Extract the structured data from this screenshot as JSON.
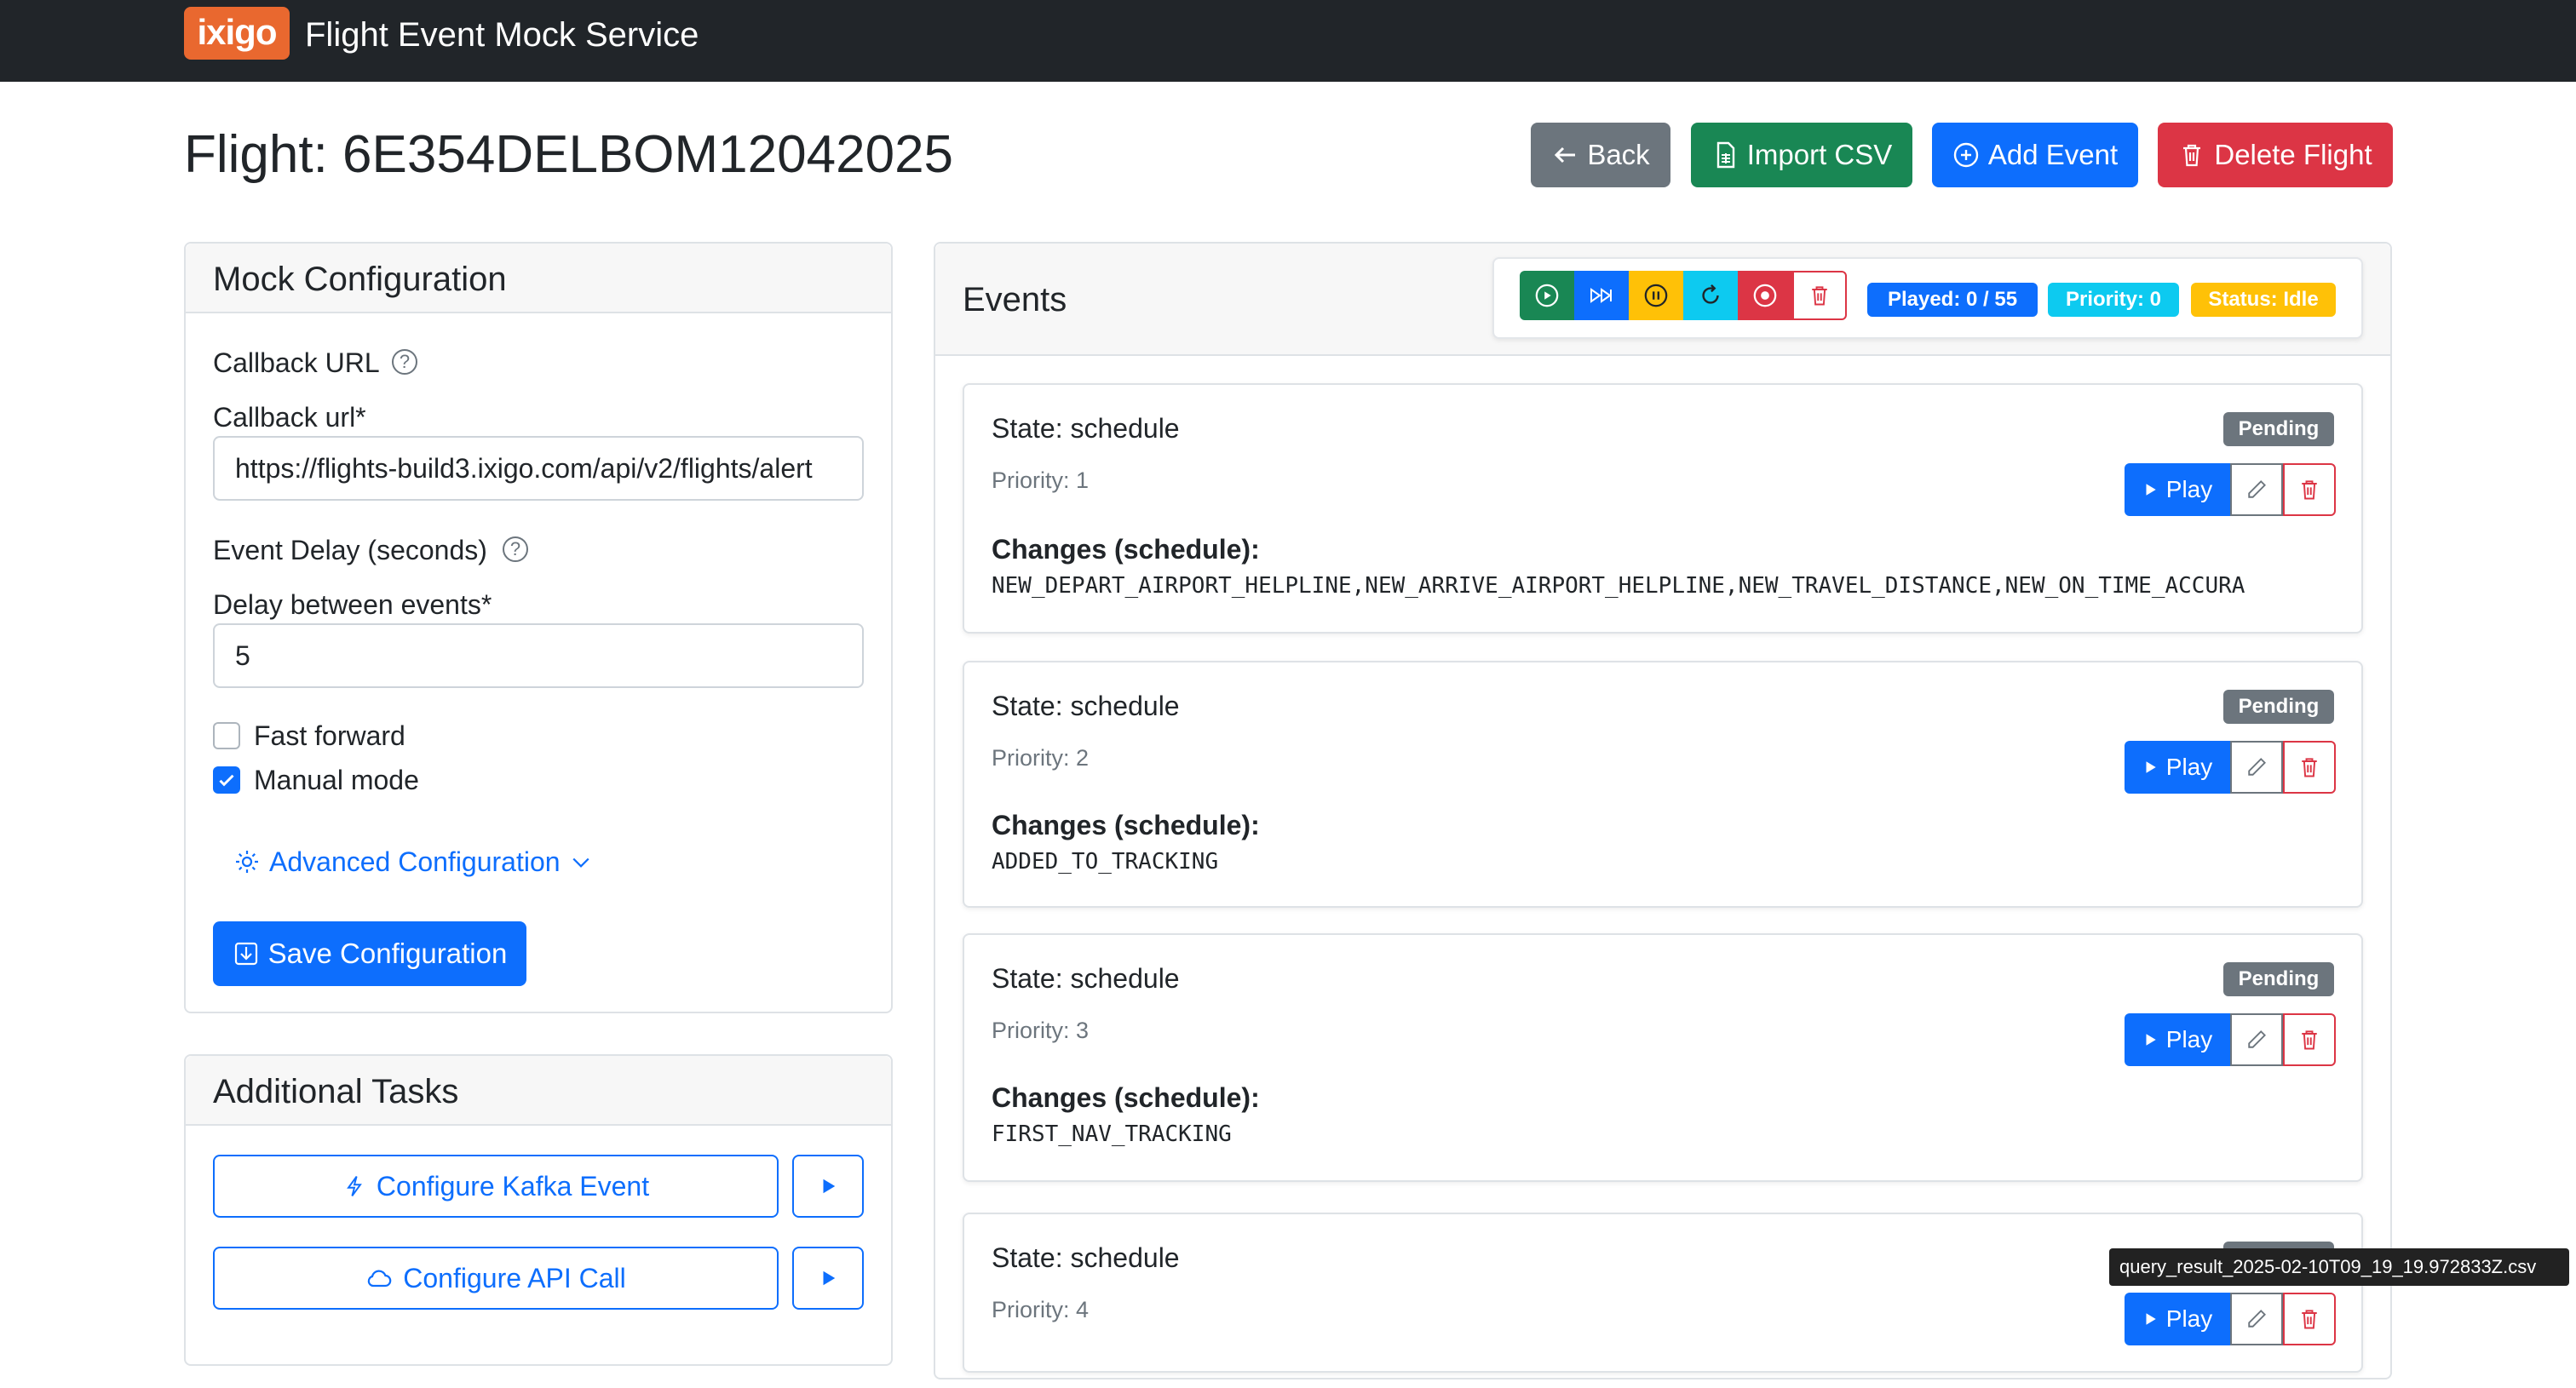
{
  "navbar": {
    "logo_text": "ixigo",
    "title": "Flight Event Mock Service"
  },
  "page": {
    "title": "Flight: 6E354DELBOM12042025"
  },
  "actions": {
    "back": "Back",
    "import_csv": "Import CSV",
    "add_event": "Add Event",
    "delete_flight": "Delete Flight"
  },
  "mock_config": {
    "title": "Mock Configuration",
    "callback_section": "Callback URL",
    "callback_label": "Callback url*",
    "callback_value": "https://flights-build3.ixigo.com/api/v2/flights/alert",
    "delay_section": "Event Delay (seconds)",
    "delay_label": "Delay between events*",
    "delay_value": "5",
    "fast_forward": {
      "label": "Fast forward",
      "checked": false
    },
    "manual_mode": {
      "label": "Manual mode",
      "checked": true
    },
    "advanced": "Advanced Configuration",
    "save": "Save Configuration"
  },
  "additional_tasks": {
    "title": "Additional Tasks",
    "kafka": "Configure Kafka Event",
    "api": "Configure API Call"
  },
  "events": {
    "title": "Events",
    "controls": [
      "play-circle-icon",
      "fast-forward-icon",
      "pause-circle-icon",
      "refresh-icon",
      "stop-circle-icon",
      "trash-icon"
    ],
    "badges": {
      "played": "Played: 0 / 55",
      "priority": "Priority: 0",
      "status": "Status: Idle"
    },
    "play_label": "Play",
    "items": [
      {
        "state": "State: schedule",
        "priority": "Priority: 1",
        "status": "Pending",
        "changes_title": "Changes (schedule):",
        "changes": "NEW_DEPART_AIRPORT_HELPLINE,NEW_ARRIVE_AIRPORT_HELPLINE,NEW_TRAVEL_DISTANCE,NEW_ON_TIME_ACCURA"
      },
      {
        "state": "State: schedule",
        "priority": "Priority: 2",
        "status": "Pending",
        "changes_title": "Changes (schedule):",
        "changes": "ADDED_TO_TRACKING"
      },
      {
        "state": "State: schedule",
        "priority": "Priority: 3",
        "status": "Pending",
        "changes_title": "Changes (schedule):",
        "changes": "FIRST_NAV_TRACKING"
      },
      {
        "state": "State: schedule",
        "priority": "Priority: 4",
        "status": "Pending"
      }
    ]
  },
  "tooltip": "query_result_2025-02-10T09_19_19.972833Z.csv",
  "colors": {
    "primary": "#0d6efd",
    "success": "#198754",
    "danger": "#dc3545",
    "secondary": "#6c757d",
    "warning": "#ffc107",
    "info": "#0dcaf0",
    "brand": "#e9682f"
  }
}
